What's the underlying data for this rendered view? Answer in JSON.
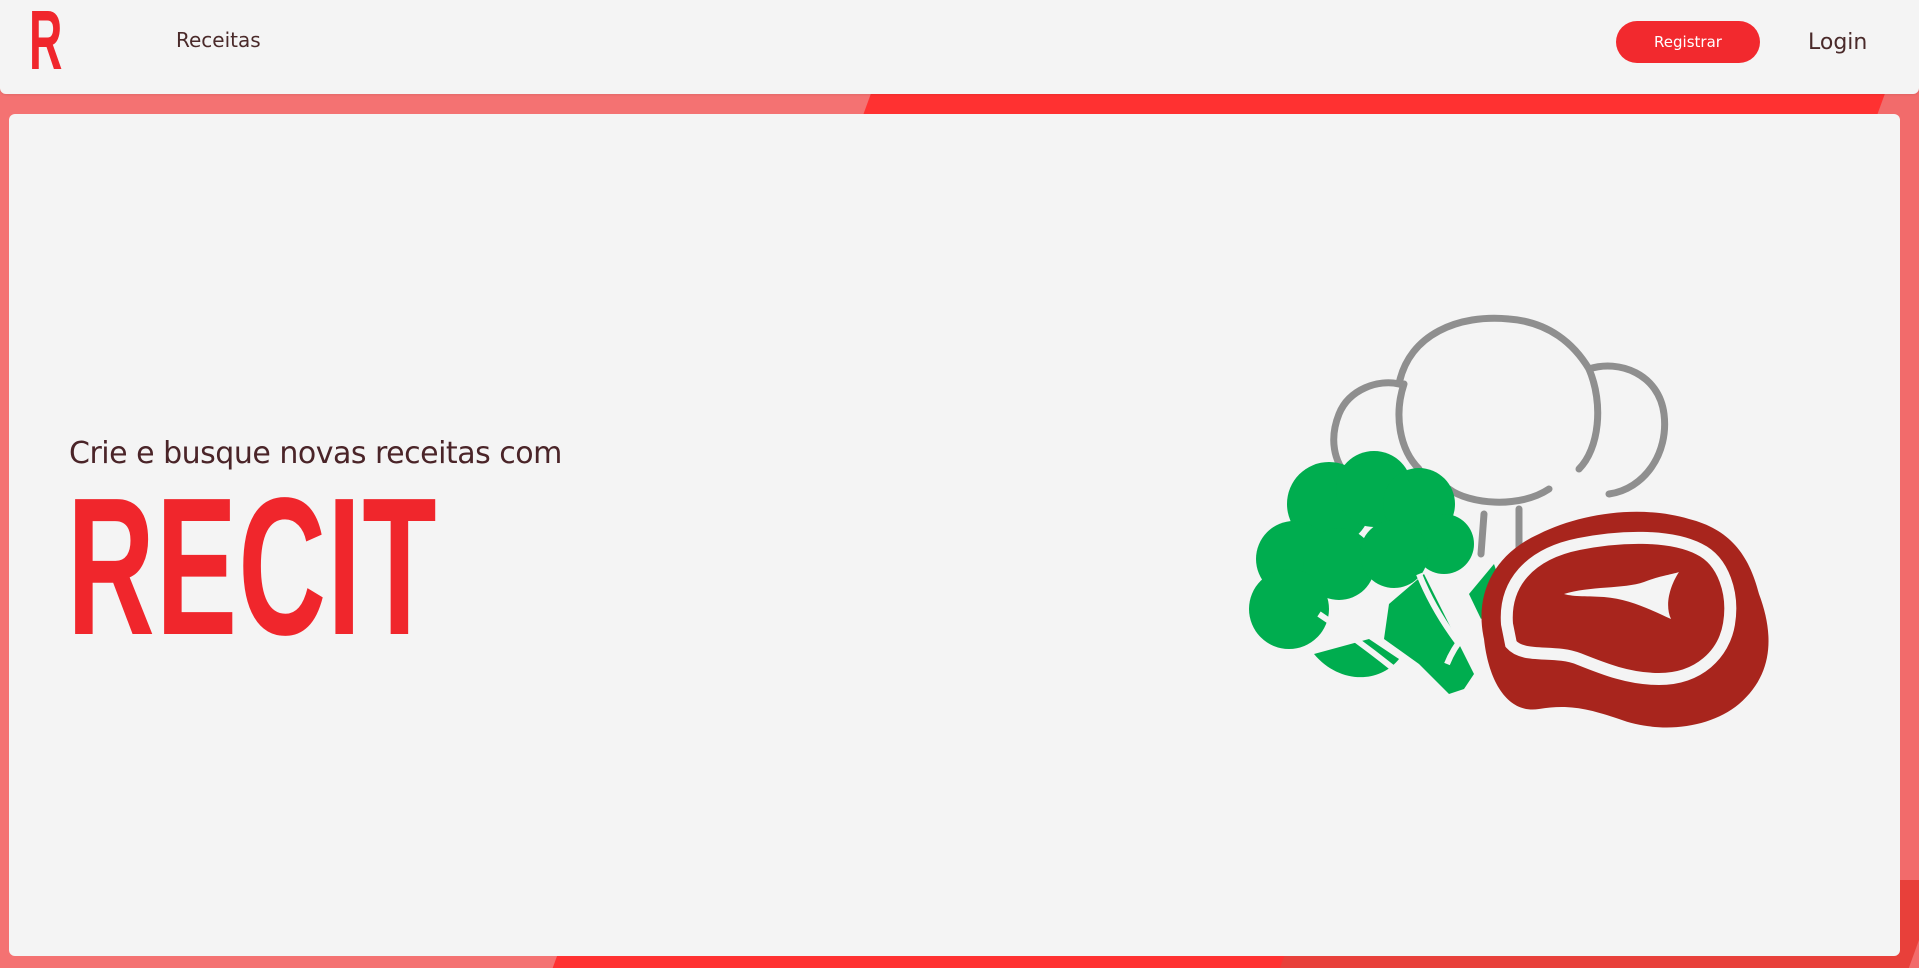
{
  "nav": {
    "logo": "R",
    "links": [
      "Receitas"
    ],
    "register_label": "Registrar",
    "login_label": "Login"
  },
  "hero": {
    "tagline": "Crie e busque novas receitas com",
    "brand": "RECIT"
  },
  "colors": {
    "accent": "#f0262c",
    "background": "#f4f4f4",
    "text": "#4a2428",
    "broccoli": "#00ad4f",
    "steak": "#a8251d",
    "chef_hat": "#8f8f8f"
  },
  "illustration_icons": [
    "chef-hat-icon",
    "broccoli-icon",
    "steak-icon"
  ]
}
